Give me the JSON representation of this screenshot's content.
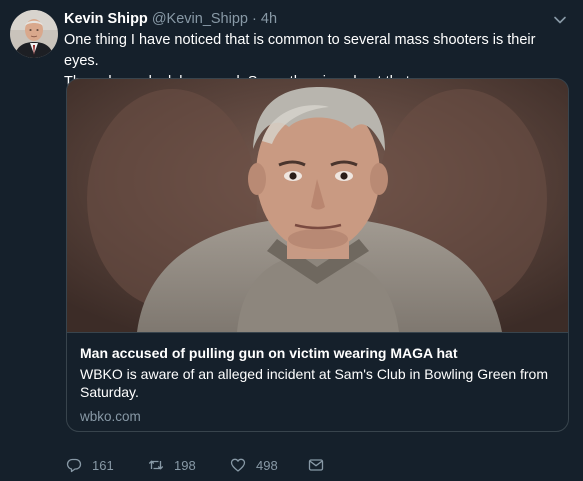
{
  "author": {
    "display_name": "Kevin Shipp",
    "handle": "@Kevin_Shipp",
    "separator": "·",
    "time": "4h"
  },
  "tweet": {
    "text_line1": "One thing I have noticed that is common to several mass shooters is their eyes.",
    "text_line2": "They always look bug-eyed. Some theories about that."
  },
  "card": {
    "title": "Man accused of pulling gun on victim wearing MAGA hat",
    "description": "WBKO is aware of an alleged incident at Sam's Club in Bowling Green from Saturday.",
    "domain": "wbko.com"
  },
  "actions": {
    "reply_count": "161",
    "retweet_count": "198",
    "like_count": "498"
  },
  "colors": {
    "background": "#15202b",
    "border": "#38444d",
    "secondary_text": "#8899a6",
    "primary_text": "#ffffff"
  },
  "icons": [
    "chevron-down-icon",
    "reply-icon",
    "retweet-icon",
    "like-icon",
    "dm-icon"
  ]
}
